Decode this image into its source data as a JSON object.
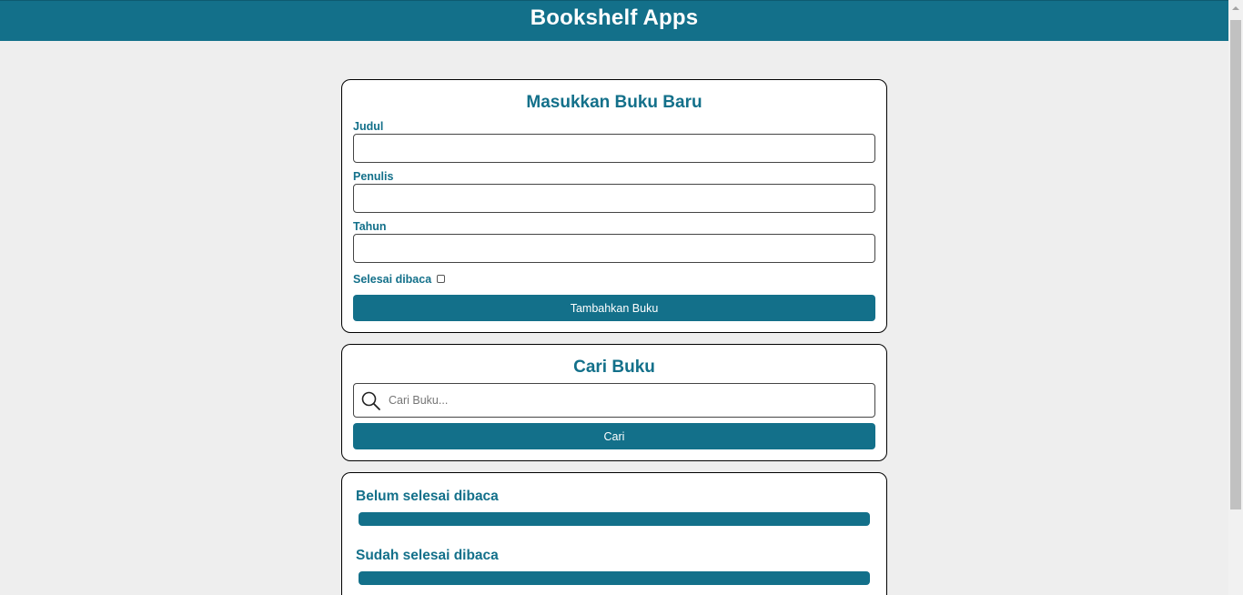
{
  "header": {
    "title": "Bookshelf Apps"
  },
  "input_section": {
    "title": "Masukkan Buku Baru",
    "fields": [
      {
        "label": "Judul",
        "value": ""
      },
      {
        "label": "Penulis",
        "value": ""
      },
      {
        "label": "Tahun",
        "value": ""
      }
    ],
    "complete_label": "Selesai dibaca",
    "complete_checked": false,
    "submit_label": "Tambahkan Buku"
  },
  "search_section": {
    "title": "Cari Buku",
    "placeholder": "Cari Buku...",
    "value": "",
    "submit_label": "Cari"
  },
  "shelves": [
    {
      "title": "Belum selesai dibaca"
    },
    {
      "title": "Sudah selesai dibaca"
    }
  ],
  "colors": {
    "primary": "#13708a",
    "background": "#eeeeee"
  }
}
